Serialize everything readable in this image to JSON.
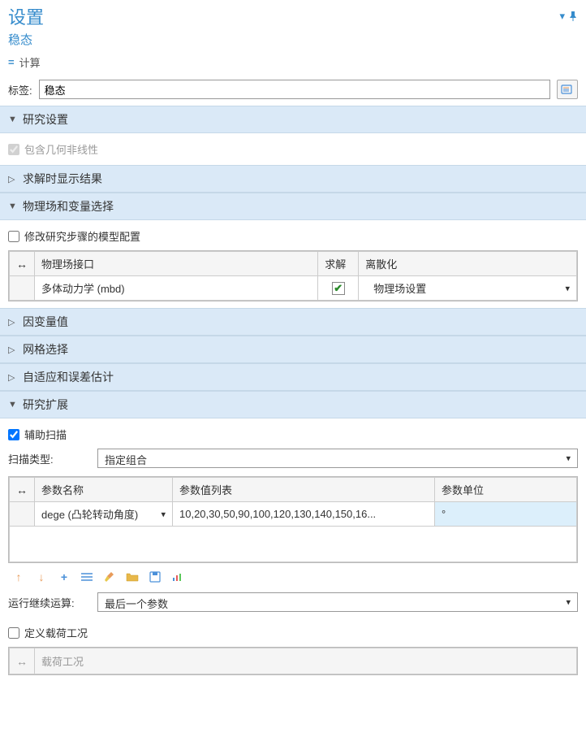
{
  "panel": {
    "title": "设置",
    "subtitle": "稳态",
    "breadcrumb_label": "计算"
  },
  "label_field": {
    "label": "标签:",
    "value": "稳态"
  },
  "sections": {
    "study_settings": {
      "title": "研究设置",
      "include_nonlinearity": "包含几何非线性"
    },
    "show_results": {
      "title": "求解时显示结果"
    },
    "physics_selection": {
      "title": "物理场和变量选择",
      "modify_model_config": "修改研究步骤的模型配置",
      "table": {
        "col_physics": "物理场接口",
        "col_solve": "求解",
        "col_discretization": "离散化",
        "row_physics": "多体动力学 (mbd)",
        "row_discretization": "物理场设置"
      }
    },
    "dependent_vars": {
      "title": "因变量值"
    },
    "mesh_selection": {
      "title": "网格选择"
    },
    "adaptation": {
      "title": "自适应和误差估计"
    },
    "study_extensions": {
      "title": "研究扩展",
      "aux_sweep": "辅助扫描",
      "sweep_type_label": "扫描类型:",
      "sweep_type_value": "指定组合",
      "param_table": {
        "col_name": "参数名称",
        "col_values": "参数值列表",
        "col_unit": "参数单位",
        "row_name": "dege (凸轮转动角度)",
        "row_values": "10,20,30,50,90,100,120,130,140,150,16...",
        "row_unit": "°"
      },
      "run_continuation_label": "运行继续运算:",
      "run_continuation_value": "最后一个参数",
      "define_load_cases": "定义载荷工况",
      "load_cases_header": "载荷工况"
    }
  }
}
